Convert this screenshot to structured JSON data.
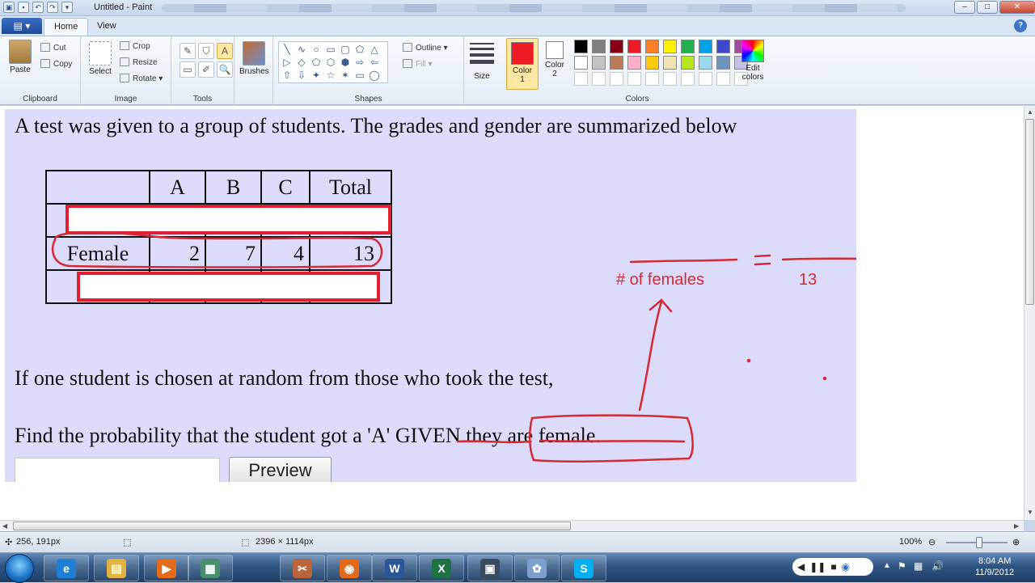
{
  "window": {
    "title": "Untitled - Paint",
    "minimize_icon": "–",
    "maximize_icon": "□",
    "close_icon": "✕"
  },
  "ribbon_tabs": {
    "home": "Home",
    "view": "View",
    "help": "?"
  },
  "clipboard": {
    "paste": "Paste",
    "cut": "Cut",
    "copy": "Copy",
    "group": "Clipboard"
  },
  "image": {
    "select": "Select",
    "crop": "Crop",
    "resize": "Resize",
    "rotate": "Rotate ▾",
    "group": "Image"
  },
  "tools": {
    "group": "Tools",
    "items": [
      "✎",
      "⛉",
      "A",
      "▭",
      "✐",
      "🔍"
    ]
  },
  "brushes": {
    "label": "Brushes"
  },
  "shapes": {
    "group": "Shapes",
    "outline": "Outline ▾",
    "fill": "Fill ▾",
    "glyphs": [
      "╲",
      "∿",
      "○",
      "▭",
      "▢",
      "⬠",
      "△",
      "▷",
      "◇",
      "⬠",
      "⬡",
      "⬢",
      "⇨",
      "⇦",
      "⇧",
      "⇩",
      "✦",
      "☆",
      "✶",
      "▭",
      "◯",
      "◻",
      "◌",
      "♡",
      "⚡"
    ]
  },
  "size": {
    "label": "Size"
  },
  "colors": {
    "group": "Colors",
    "color1_label": "Color\n1",
    "color1_a": "Color",
    "color1_b": "1",
    "color2_a": "Color",
    "color2_b": "2",
    "color1": "#ed1c24",
    "color2": "#ffffff",
    "edit": "Edit colors",
    "palette": [
      "#000000",
      "#7f7f7f",
      "#880015",
      "#ed1c24",
      "#ff7f27",
      "#fff200",
      "#22b14c",
      "#00a2e8",
      "#3f48cc",
      "#a349a4",
      "#ffffff",
      "#c3c3c3",
      "#b97a57",
      "#ffaec9",
      "#ffc90e",
      "#efe4b0",
      "#b5e61d",
      "#99d9ea",
      "#7092be",
      "#c8bfe7",
      "#ffffff",
      "#ffffff",
      "#ffffff",
      "#ffffff",
      "#ffffff",
      "#ffffff",
      "#ffffff",
      "#ffffff",
      "#ffffff",
      "#ffffff"
    ]
  },
  "canvas": {
    "intro": "A test was given to a group of students. The grades and gender are summarized below",
    "table": {
      "headers": [
        "",
        "A",
        "B",
        "C",
        "Total"
      ],
      "female_row": [
        "Female",
        "2",
        "7",
        "4",
        "13"
      ]
    },
    "question1": "If one student is chosen at random from those who took the test,",
    "question2_pre": "Find the probability that the student got a 'A' ",
    "question2_given": "GIVEN",
    "question2_post": " they are female.",
    "preview_button": "Preview",
    "ink_numerator": "# of females",
    "ink_denominator": "13",
    "ink_color": "#d42a36"
  },
  "statusbar": {
    "cursor": "256, 191px",
    "size": "2396 × 1114px",
    "zoom": "100%"
  },
  "taskbar": {
    "time": "8:04 AM",
    "date": "11/9/2012",
    "apps": [
      {
        "icon": "ie-icon",
        "glyph": "e",
        "color": "#1f7fd4"
      },
      {
        "icon": "explorer-icon",
        "glyph": "▤",
        "color": "#e3b341"
      },
      {
        "icon": "media-icon",
        "glyph": "▶",
        "color": "#e46b1a"
      },
      {
        "icon": "folder-icon",
        "glyph": "▦",
        "color": "#4c8f6e"
      },
      {
        "icon": "tool-icon",
        "glyph": "✂",
        "color": "#b8643c"
      },
      {
        "icon": "firefox-icon",
        "glyph": "◉",
        "color": "#e36a1c"
      },
      {
        "icon": "word-icon",
        "glyph": "W",
        "color": "#2b5797"
      },
      {
        "icon": "excel-icon",
        "glyph": "X",
        "color": "#1f7244"
      },
      {
        "icon": "terminal-icon",
        "glyph": "▣",
        "color": "#3a4b5f"
      },
      {
        "icon": "paint-icon",
        "glyph": "✿",
        "color": "#7b9fcf"
      },
      {
        "icon": "skype-icon",
        "glyph": "S",
        "color": "#00aff0"
      }
    ]
  }
}
